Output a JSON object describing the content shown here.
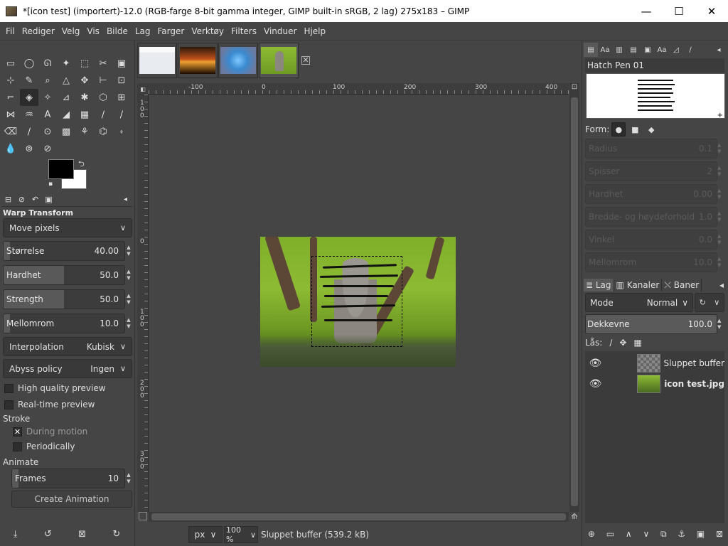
{
  "window": {
    "title": "*[icon test] (importert)-12.0 (RGB-farge 8-bit gamma integer, GIMP built-in sRGB, 2 lag) 275x183 – GIMP",
    "minimize": "—",
    "maximize": "☐",
    "close": "✕"
  },
  "menu": [
    "Fil",
    "Rediger",
    "Velg",
    "Vis",
    "Bilde",
    "Lag",
    "Farger",
    "Verktøy",
    "Filters",
    "Vinduer",
    "Hjelp"
  ],
  "toolbox": {
    "tools": [
      "▭",
      "◯",
      "ᘏ",
      "✦",
      "⬚",
      "✂",
      "▣",
      "⊹",
      "✎",
      "⌕",
      "△",
      "✥",
      "⊢",
      "⊡",
      "⌐",
      "◈",
      "✧",
      "⊿",
      "✱",
      "⬡",
      "⊞",
      "⋈",
      "♒",
      "A",
      "◢",
      "▦",
      "∕",
      "∕",
      "⌫",
      "∕",
      "⊙",
      "▩",
      "⚘",
      "⌬",
      "⬫",
      "💧",
      "⊚",
      "⊘"
    ],
    "active_tool_index": 15,
    "fg_color": "#000000",
    "bg_color": "#ffffff",
    "swap_icon": "⮌",
    "reset_icon": "▪"
  },
  "options": {
    "tab_icons": [
      "⊟",
      "⊘",
      "↶",
      "▣"
    ],
    "title": "Warp Transform",
    "behavior": "Move pixels",
    "size_label": "Størrelse",
    "size_value": "40.00",
    "size_fill": 0.05,
    "hardness_label": "Hardhet",
    "hardness_value": "50.0",
    "hardness_fill": 0.5,
    "strength_label": "Strength",
    "strength_value": "50.0",
    "strength_fill": 0.5,
    "spacing_label": "Mellomrom",
    "spacing_value": "10.0",
    "spacing_fill": 0.05,
    "interpolation_label": "Interpolation",
    "interpolation_value": "Kubisk",
    "abyss_label": "Abyss policy",
    "abyss_value": "Ingen",
    "hq_preview": "High quality preview",
    "rt_preview": "Real-time preview",
    "stroke_label": "Stroke",
    "during_motion": "During motion",
    "periodically": "Periodically",
    "animate_label": "Animate",
    "frames_label": "Frames",
    "frames_value": "10",
    "create_animation": "Create Animation",
    "bottom_icons": [
      "⤓",
      "↺",
      "⊠",
      "↻"
    ]
  },
  "canvas": {
    "ruler_top": [
      "-100",
      "0",
      "100",
      "200",
      "300",
      "400"
    ],
    "ruler_left": [
      "1\n0\n0",
      "0",
      "1\n0\n0",
      "2\n0\n0",
      "3\n0\n0"
    ],
    "unit": "px",
    "zoom": "100 %",
    "status": "Sluppet buffer (539.2 kB)"
  },
  "right": {
    "brush_name": "Hatch Pen 01",
    "form_label": "Form:",
    "dim_rows": [
      {
        "label": "Radius",
        "value": "0.1"
      },
      {
        "label": "Spisser",
        "value": "2"
      },
      {
        "label": "Hardhet",
        "value": "0.00"
      },
      {
        "label": "Bredde- og høydeforhold",
        "value": "1.0"
      },
      {
        "label": "Vinkel",
        "value": "0.0"
      },
      {
        "label": "Mellomrom",
        "value": "10.0"
      }
    ],
    "tabs": [
      "Lag",
      "Kanaler",
      "Baner"
    ],
    "mode_label": "Mode",
    "mode_value": "Normal",
    "opacity_label": "Dekkevne",
    "opacity_value": "100.0",
    "lock_label": "Lås:",
    "layers": [
      {
        "name": "Sluppet buffer",
        "bold": false
      },
      {
        "name": "icon test.jpg",
        "bold": true
      }
    ]
  }
}
